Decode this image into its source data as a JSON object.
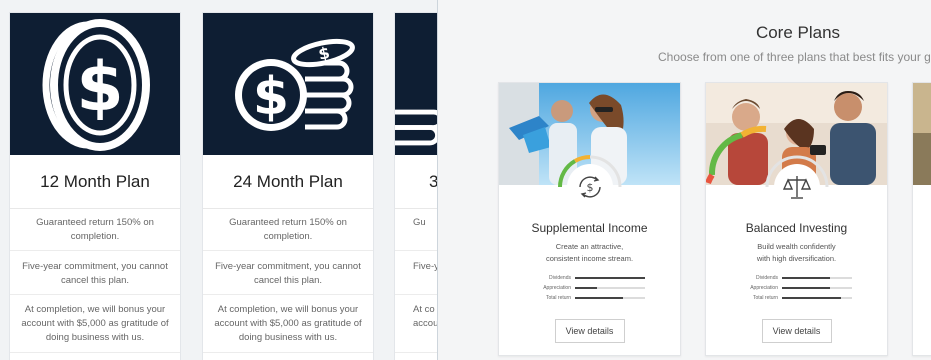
{
  "left_plans": [
    {
      "title": "12 Month Plan",
      "guarantee": "Guaranteed return 150% on completion.",
      "commitment": "Five-year commitment, you cannot cancel this plan.",
      "bonus": "At completion, we will bonus your account with $5,000 as gratitude of doing business with us."
    },
    {
      "title": "24 Month Plan",
      "guarantee": "Guaranteed return 150% on completion.",
      "commitment": "Five-year commitment, you cannot cancel this plan.",
      "bonus": "At completion, we will bonus your account with $5,000 as gratitude of doing business with us."
    },
    {
      "title": "3",
      "guarantee": "Gu",
      "commitment": "Five-y",
      "bonus_line1": "At co",
      "bonus_line2": "accou"
    }
  ],
  "core": {
    "title": "Core Plans",
    "subtitle": "Choose from one of three plans that best fits your goal",
    "cards": [
      {
        "name": "Supplemental Income",
        "desc_line1": "Create an attractive,",
        "desc_line2": "consistent income stream.",
        "metrics": [
          {
            "label": "Dividends",
            "value": 1.0
          },
          {
            "label": "Appreciation",
            "value": 0.32
          },
          {
            "label": "Total return",
            "value": 0.68
          }
        ],
        "button": "View details",
        "icon": "dollar-cycle-icon"
      },
      {
        "name": "Balanced Investing",
        "desc_line1": "Build wealth confidently",
        "desc_line2": "with high diversification.",
        "metrics": [
          {
            "label": "Dividends",
            "value": 0.68
          },
          {
            "label": "Appreciation",
            "value": 0.68
          },
          {
            "label": "Total return",
            "value": 0.84
          }
        ],
        "button": "View details",
        "icon": "balance-scale-icon"
      }
    ]
  },
  "colors": {
    "hero_bg": "#0e1e33",
    "accent_gradient": [
      "#e8553f",
      "#f2b233",
      "#63b946",
      "#2aa3d8"
    ]
  }
}
